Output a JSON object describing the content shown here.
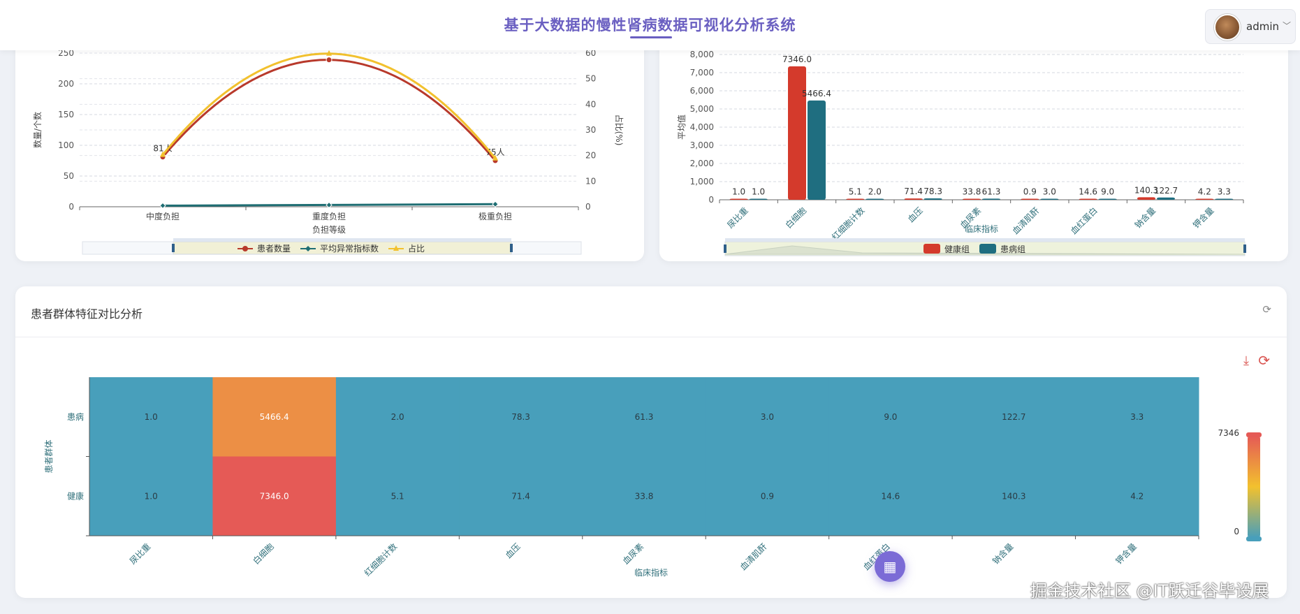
{
  "header": {
    "title": "基于大数据的慢性肾病数据可视化分析系统",
    "user_name": "admin"
  },
  "bottom_card": {
    "title": "患者群体特征对比分析"
  },
  "watermark": "掘金技术社区 @IT跃迁谷毕设展",
  "colors": {
    "accent": "#6a5fc1",
    "patients": "#b8392b",
    "abnormal": "#1f6e73",
    "ratio": "#f2c12e",
    "healthy_bar": "#d43a2c",
    "sick_bar": "#1f6e80"
  },
  "chart_data": [
    {
      "type": "line",
      "categories": [
        "中度负担",
        "重度负担",
        "极重负担"
      ],
      "xlabel": "负担等级",
      "ylabel": "数量/个数",
      "ylabel_right": "占比(%)",
      "ylim": [
        0,
        250
      ],
      "ylim_right": [
        0,
        60
      ],
      "yticks": [
        0,
        50,
        100,
        150,
        200,
        250
      ],
      "yticks_right": [
        0,
        10,
        20,
        30,
        40,
        50,
        60
      ],
      "series": [
        {
          "name": "患者数量",
          "values": [
            81,
            239,
            75
          ],
          "labels": [
            "81人",
            "",
            "75人"
          ],
          "axis": "left",
          "color": "#b8392b",
          "marker": "circle"
        },
        {
          "name": "平均异常指标数",
          "values": [
            1.8,
            2.8,
            4.2
          ],
          "axis": "left",
          "color": "#1f6e73",
          "marker": "diamond"
        },
        {
          "name": "占比",
          "values": [
            20.3,
            59.8,
            18.9
          ],
          "axis": "right",
          "color": "#f2c12e",
          "marker": "triangle"
        }
      ],
      "legend": "bottom",
      "grid": true
    },
    {
      "type": "bar",
      "categories": [
        "尿比重",
        "白细胞",
        "红细胞计数",
        "血压",
        "血尿素",
        "血清肌酐",
        "血红蛋白",
        "钠含量",
        "钾含量"
      ],
      "xlabel": "临床指标",
      "ylabel": "平均值",
      "ylim": [
        0,
        8000
      ],
      "yticks": [
        "0",
        "1,000",
        "2,000",
        "3,000",
        "4,000",
        "5,000",
        "6,000",
        "7,000",
        "8,000"
      ],
      "series": [
        {
          "name": "健康组",
          "values": [
            1.0,
            7346.0,
            5.1,
            71.4,
            33.8,
            0.9,
            14.6,
            140.3,
            4.2
          ],
          "color": "#d43a2c"
        },
        {
          "name": "患病组",
          "values": [
            1.0,
            5466.4,
            2.0,
            78.3,
            61.3,
            3.0,
            9.0,
            122.7,
            3.3
          ],
          "color": "#1f6e80"
        }
      ],
      "value_labels": [
        [
          "1.0",
          "7346.0",
          "5.1",
          "71.4",
          "33.8",
          "0.9",
          "14.6",
          "140.3",
          "4.2"
        ],
        [
          "1.0",
          "5466.4",
          "2.0",
          "78.3",
          "61.3",
          "3.0",
          "9.0",
          "122.7",
          "3.3"
        ]
      ],
      "legend": "bottom",
      "grid": true
    },
    {
      "type": "heatmap",
      "x_categories": [
        "尿比重",
        "白细胞",
        "红细胞计数",
        "血压",
        "血尿素",
        "血清肌酐",
        "血红蛋白",
        "钠含量",
        "钾含量"
      ],
      "y_categories": [
        "患病",
        "健康"
      ],
      "xlabel": "临床指标",
      "ylabel": "患者群体",
      "values": [
        [
          1.0,
          5466.4,
          2.0,
          78.3,
          61.3,
          3.0,
          9.0,
          122.7,
          3.3
        ],
        [
          1.0,
          7346.0,
          5.1,
          71.4,
          33.8,
          0.9,
          14.6,
          140.3,
          4.2
        ]
      ],
      "labels": [
        [
          "1.0",
          "5466.4",
          "2.0",
          "78.3",
          "61.3",
          "3.0",
          "9.0",
          "122.7",
          "3.3"
        ],
        [
          "1.0",
          "7346.0",
          "5.1",
          "71.4",
          "33.8",
          "0.9",
          "14.6",
          "140.3",
          "4.2"
        ]
      ],
      "visual_map": {
        "min": 0,
        "max": 7346,
        "min_label": "0",
        "max_label": "7346"
      }
    }
  ]
}
